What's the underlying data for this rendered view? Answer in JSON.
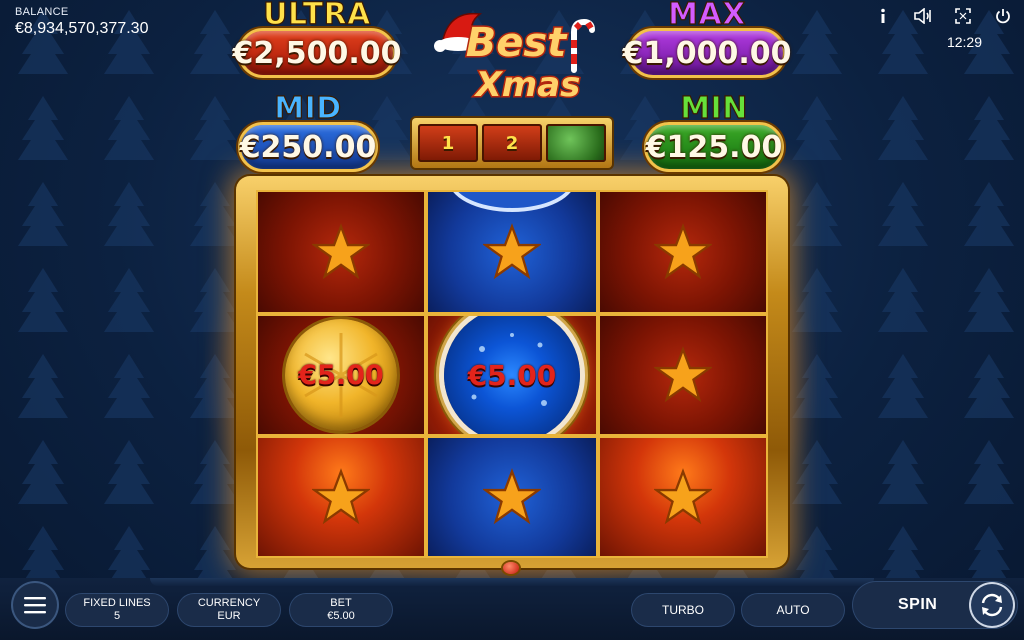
{
  "balance": {
    "label": "BALANCE",
    "value": "€8,934,570,377.30"
  },
  "clock": "12:29",
  "top_icons": [
    "info-icon",
    "sound-icon",
    "fullscreen-icon",
    "power-icon"
  ],
  "logo": {
    "line1": "Best",
    "line2": "Xmas"
  },
  "jackpots": {
    "ultra": {
      "name": "ULTRA",
      "amount": "€2,500.00"
    },
    "max": {
      "name": "MAX",
      "amount": "€1,000.00"
    },
    "mid": {
      "name": "MID",
      "amount": "€250.00"
    },
    "min": {
      "name": "MIN",
      "amount": "€125.00"
    }
  },
  "progress": [
    "1",
    "2",
    ""
  ],
  "reels": {
    "coin_gold": "€5.00",
    "coin_blue": "€5.00"
  },
  "controls": {
    "fixed_lines_label": "FIXED LINES",
    "fixed_lines_value": "5",
    "currency_label": "CURRENCY",
    "currency_value": "EUR",
    "bet_label": "BET",
    "bet_value": "€5.00",
    "turbo_label": "TURBO",
    "auto_label": "AUTO",
    "spin_label": "SPIN"
  },
  "colors": {
    "background": "#0c2140",
    "gold": "#f3c24a",
    "ultra": "#e2401d",
    "max": "#b23ce0",
    "mid": "#2c6fe0",
    "min": "#3caa27"
  }
}
